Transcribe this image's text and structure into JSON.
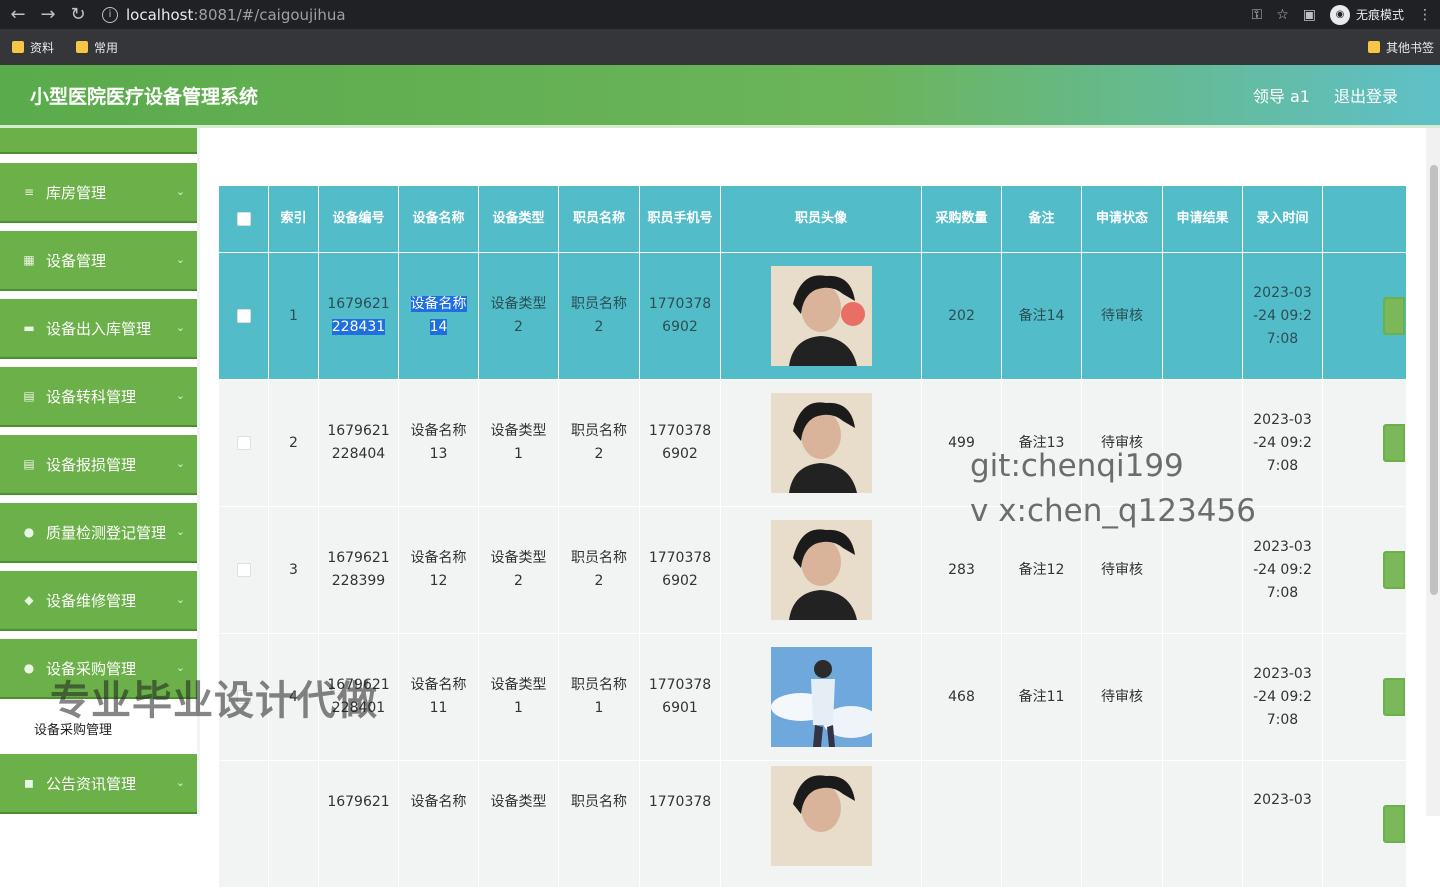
{
  "browser": {
    "url_host": "localhost",
    "url_path": ":8081/#/caigoujihua",
    "incognito_label": "无痕模式",
    "bookmarks": [
      "资料",
      "常用"
    ],
    "bookmarks_right": "其他书签"
  },
  "app": {
    "title": "小型医院医疗设备管理系统",
    "user": "领导 a1",
    "logout": "退出登录"
  },
  "sidebar": {
    "items": [
      {
        "label": "库房管理",
        "icon": "list-icon"
      },
      {
        "label": "设备管理",
        "icon": "grid-icon"
      },
      {
        "label": "设备出入库管理",
        "icon": "box-icon"
      },
      {
        "label": "设备转科管理",
        "icon": "clipboard-icon"
      },
      {
        "label": "设备报损管理",
        "icon": "clipboard-icon"
      },
      {
        "label": "质量检测登记管理",
        "icon": "user-icon"
      },
      {
        "label": "设备维修管理",
        "icon": "thumb-icon"
      },
      {
        "label": "设备采购管理",
        "icon": "bulb-icon"
      },
      {
        "label": "公告资讯管理",
        "icon": "bell-icon"
      }
    ],
    "submenu_label": "设备采购管理"
  },
  "table": {
    "headers": [
      "索引",
      "设备编号",
      "设备名称",
      "设备类型",
      "职员名称",
      "职员手机号",
      "职员头像",
      "采购数量",
      "备注",
      "申请状态",
      "申请结果",
      "录入时间"
    ],
    "rows": [
      {
        "idx": "1",
        "code_a": "1679621",
        "code_b": "228431",
        "name_a": "设备名称",
        "name_b": "14",
        "type_a": "设备类型",
        "type_b": "2",
        "staff_a": "职员名称",
        "staff_b": "2",
        "phone_a": "1770378",
        "phone_b": "6902",
        "qty": "202",
        "note": "备注14",
        "status": "待审核",
        "result": "",
        "time_a": "2023-03",
        "time_b": "-24 09:2",
        "time_c": "7:08"
      },
      {
        "idx": "2",
        "code_a": "1679621",
        "code_b": "228404",
        "name_a": "设备名称",
        "name_b": "13",
        "type_a": "设备类型",
        "type_b": "1",
        "staff_a": "职员名称",
        "staff_b": "2",
        "phone_a": "1770378",
        "phone_b": "6902",
        "qty": "499",
        "note": "备注13",
        "status": "待审核",
        "result": "",
        "time_a": "2023-03",
        "time_b": "-24 09:2",
        "time_c": "7:08"
      },
      {
        "idx": "3",
        "code_a": "1679621",
        "code_b": "228399",
        "name_a": "设备名称",
        "name_b": "12",
        "type_a": "设备类型",
        "type_b": "2",
        "staff_a": "职员名称",
        "staff_b": "2",
        "phone_a": "1770378",
        "phone_b": "6902",
        "qty": "283",
        "note": "备注12",
        "status": "待审核",
        "result": "",
        "time_a": "2023-03",
        "time_b": "-24 09:2",
        "time_c": "7:08"
      },
      {
        "idx": "4",
        "code_a": "1679621",
        "code_b": "228401",
        "name_a": "设备名称",
        "name_b": "11",
        "type_a": "设备类型",
        "type_b": "1",
        "staff_a": "职员名称",
        "staff_b": "1",
        "phone_a": "1770378",
        "phone_b": "6901",
        "qty": "468",
        "note": "备注11",
        "status": "待审核",
        "result": "",
        "time_a": "2023-03",
        "time_b": "-24 09:2",
        "time_c": "7:08"
      },
      {
        "idx": "",
        "code_a": "1679621",
        "code_b": "",
        "name_a": "设备名称",
        "name_b": "",
        "type_a": "设备类型",
        "type_b": "",
        "staff_a": "职员名称",
        "staff_b": "",
        "phone_a": "1770378",
        "phone_b": "",
        "qty": "",
        "note": "",
        "status": "",
        "result": "",
        "time_a": "2023-03",
        "time_b": "",
        "time_c": ""
      }
    ]
  },
  "watermark": {
    "line1": "git:chenqi199",
    "line2": "v x:chen_q123456",
    "overlay": "专业毕业设计代做"
  },
  "colors": {
    "header_green": "#5aab4b",
    "table_header": "#53bcc9",
    "menu_green": "#6bb048"
  }
}
